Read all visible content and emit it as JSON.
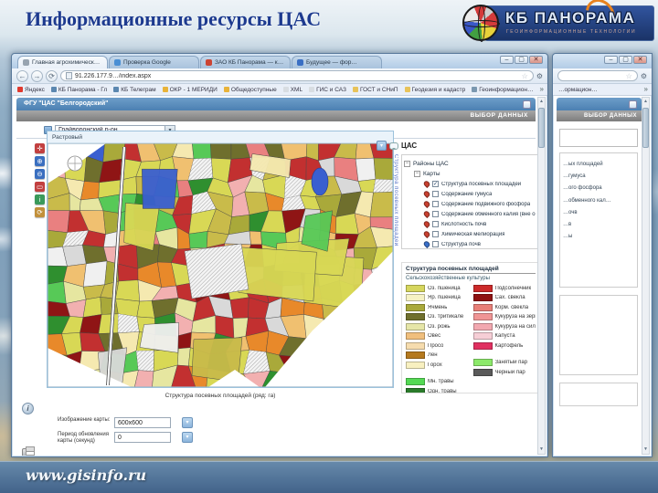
{
  "slide": {
    "title": "Информационные ресурсы ЦАС",
    "footer_url": "www.gisinfo.ru",
    "logo": {
      "brand": "КБ ПАНОРАМА",
      "subtitle": "ГЕОИНФОРМАЦИОННЫЕ ТЕХНОЛОГИИ"
    }
  },
  "icons": {
    "back": "←",
    "forward": "→",
    "reload": "⟳",
    "star": "☆",
    "wrench": "⚙",
    "minimize": "–",
    "maximize": "▢",
    "close": "✕",
    "dropdown": "▾",
    "up": "▲",
    "down": "▼",
    "minus": "−",
    "info": "i",
    "chevron": "»"
  },
  "browser": {
    "address": "91.226.177.9…/index.aspx",
    "tabs": [
      {
        "title": "Главная агрохимическ…",
        "color": "#98a4b0",
        "active": true
      },
      {
        "title": "Проверка Google",
        "color": "#4a8fd4"
      },
      {
        "title": "ЗАО КБ Панорама — ка…",
        "color": "#cc4433"
      },
      {
        "title": "Будущее — фор…",
        "color": "#3a6fc4"
      }
    ],
    "bookmarks": [
      {
        "label": "Яндекс",
        "color": "#e0392e"
      },
      {
        "label": "КБ Панорама - Гл",
        "color": "#5b87b0"
      },
      {
        "label": "КБ Телеграм",
        "color": "#5b87b0"
      },
      {
        "label": "ОКР - 1 МЕРИДИ",
        "color": "#e8b33a"
      },
      {
        "label": "Общедоступные",
        "color": "#e8b33a"
      },
      {
        "label": "XML",
        "color": "#d8dde2"
      },
      {
        "label": "ГИС и САЗ",
        "color": "#d8dde2"
      },
      {
        "label": "ГОСТ и СНиП",
        "color": "#e8c35a"
      },
      {
        "label": "Геодезия и кадастр",
        "color": "#e8c35a"
      },
      {
        "label": "Геоинформацион…",
        "color": "#7b98b0"
      }
    ]
  },
  "page": {
    "header_title": "ФГУ \"ЦАС \"Белгородский\"",
    "toolbar_label": "ВЫБОР ДАННЫХ",
    "district_select": "Грайворонский р-он",
    "map_tab": "Растровый",
    "map_caption": "Структура посевных площадей (ряд: га)",
    "vertical_label": "Структура посевных площадей",
    "cas_label": "ЦАС",
    "map_tools": [
      {
        "glyph": "✛",
        "bg": "#c24040"
      },
      {
        "glyph": "⊕",
        "bg": "#3a6fc0"
      },
      {
        "glyph": "⊖",
        "bg": "#3a6fc0"
      },
      {
        "glyph": "▭",
        "bg": "#c24040"
      },
      {
        "glyph": "i",
        "bg": "#3a9a5a"
      },
      {
        "glyph": "⟳",
        "bg": "#c2903a"
      }
    ],
    "form_rows": [
      {
        "label": "Изображение карты:",
        "value": "600x600"
      },
      {
        "label": "Период обновления карты (секунд)",
        "value": "0"
      }
    ]
  },
  "layers": {
    "root": "Районы ЦАС",
    "group": "Карты",
    "items": [
      {
        "label": "Структура посевных площадей",
        "checked": true,
        "marker": "#c84030"
      },
      {
        "label": "Содержание гумуса",
        "marker": "#c84030"
      },
      {
        "label": "Содержание подвижного фосфора",
        "marker": "#c84030"
      },
      {
        "label": "Содержание обменного калия (вне обсл.)",
        "marker": "#c84030"
      },
      {
        "label": "Кислотность почв",
        "marker": "#c84030"
      },
      {
        "label": "Химическая мелиорация",
        "marker": "#c84030"
      },
      {
        "label": "Структура почв",
        "marker": "#3a6fc8"
      }
    ]
  },
  "legend": {
    "title": "Структура посевных площадей",
    "subtitle": "Сельскохозяйственные культуры",
    "col1": [
      {
        "label": "Оз. пшеница",
        "color": "#d6d65e"
      },
      {
        "label": "Яр. пшеница",
        "color": "#f6f2c4"
      },
      {
        "label": "Ячмень",
        "color": "#a9a93a"
      },
      {
        "label": "Оз. тритикале",
        "color": "#6f6f2d"
      },
      {
        "label": "Оз. рожь",
        "color": "#e6e6a8"
      },
      {
        "label": "Овес",
        "color": "#f0bf7d"
      },
      {
        "label": "Просо",
        "color": "#f6dcae"
      },
      {
        "label": "Лен",
        "color": "#b5791e"
      },
      {
        "label": "Горох",
        "color": "#f8f0c0"
      },
      {
        "spacer": true
      },
      {
        "label": "Мн. травы",
        "color": "#54d954"
      },
      {
        "label": "Одн. травы",
        "color": "#2a7a2a"
      }
    ],
    "col2": [
      {
        "label": "Подсолнечник",
        "color": "#cc2a2a"
      },
      {
        "label": "Сах. свекла",
        "color": "#8f1212"
      },
      {
        "label": "Корм. свекла",
        "color": "#e87f78"
      },
      {
        "label": "Кукуруза на зерно",
        "color": "#f09595"
      },
      {
        "label": "Кукуруза на сил.",
        "color": "#f2a8b0"
      },
      {
        "label": "Капуста",
        "color": "#f6ced6"
      },
      {
        "label": "Картофель",
        "color": "#e03060"
      },
      {
        "spacer": true
      },
      {
        "label": "Занятый пар",
        "color": "#8ce96a"
      },
      {
        "label": "Черный пар",
        "color": "#5a5a5a"
      }
    ]
  },
  "right_window": {
    "toolbar_label": "ВЫБОР ДАННЫХ",
    "bookmark": "…ормацион…",
    "lines": [
      "…ых площадей",
      "…гумуса",
      "…ого фосфора",
      "…обменного кал…",
      "…очв",
      "…в",
      "…ы"
    ]
  },
  "map": {
    "palette": [
      {
        "c": "#d8d855",
        "w": 0.12
      },
      {
        "c": "#c9bb4a",
        "w": 0.08
      },
      {
        "c": "#a9a93a",
        "w": 0.07
      },
      {
        "c": "#6f6f2d",
        "w": 0.04
      },
      {
        "c": "#e6e6a0",
        "w": 0.05
      },
      {
        "c": "#f5e9b0",
        "w": 0.05
      },
      {
        "c": "#c23030",
        "w": 0.1
      },
      {
        "c": "#8f1515",
        "w": 0.05
      },
      {
        "c": "#e98080",
        "w": 0.06
      },
      {
        "c": "#f2b0b0",
        "w": 0.04
      },
      {
        "c": "#57c957",
        "w": 0.06
      },
      {
        "c": "#2f8f2f",
        "w": 0.04
      },
      {
        "c": "#f0f0f0",
        "w": 0.1
      },
      {
        "c": "#d9d9d9",
        "w": 0.03
      },
      {
        "c": "#e8892a",
        "w": 0.04
      },
      {
        "c": "#f0c070",
        "w": 0.04
      },
      {
        "c": "#3a5fd0",
        "w": 0.01
      }
    ]
  }
}
